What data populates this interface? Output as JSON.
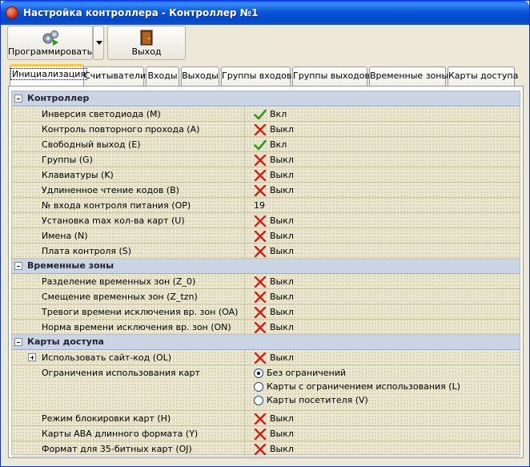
{
  "window": {
    "title": "Настройка контроллера - Контроллер №1"
  },
  "toolbar": {
    "program_label": "Программировать",
    "exit_label": "Выход"
  },
  "tabs": [
    "Инициализация",
    "Считыватели",
    "Входы",
    "Выходы",
    "Группы входов",
    "Группы выходов",
    "Временные зоны",
    "Карты доступа"
  ],
  "active_tab": "Инициализация",
  "colors": {
    "on": "#2e9a1f",
    "off": "#d22018",
    "accent": "#ffc83c"
  },
  "sections": {
    "controller": {
      "title": "Контроллер",
      "rows": [
        {
          "name": "Инверсия светодиода (M)",
          "value": "Вкл",
          "icon": "check-icon"
        },
        {
          "name": "Контроль повторного прохода (A)",
          "value": "Выкл",
          "icon": "cross-icon"
        },
        {
          "name": "Свободный выход (E)",
          "value": "Вкл",
          "icon": "check-icon"
        },
        {
          "name": "Группы (G)",
          "value": "Выкл",
          "icon": "cross-icon"
        },
        {
          "name": "Клавиатуры (K)",
          "value": "Выкл",
          "icon": "cross-icon"
        },
        {
          "name": "Удлиненное чтение кодов (B)",
          "value": "Выкл",
          "icon": "cross-icon"
        },
        {
          "name": "№ входа контроля питания (OP)",
          "value": "19",
          "icon": ""
        },
        {
          "name": "Установка max кол-ва карт (U)",
          "value": "Выкл",
          "icon": "cross-icon"
        },
        {
          "name": "Имена (N)",
          "value": "Выкл",
          "icon": "cross-icon"
        },
        {
          "name": "Плата контроля (S)",
          "value": "Выкл",
          "icon": "cross-icon"
        }
      ]
    },
    "time_zones": {
      "title": "Временные зоны",
      "rows": [
        {
          "name": "Разделение временных зон (Z_0)",
          "value": "Выкл",
          "icon": "cross-icon"
        },
        {
          "name": "Смещение временных зон (Z_tzn)",
          "value": "Выкл",
          "icon": "cross-icon"
        },
        {
          "name": "Тревоги времени исключения вр. зон (OA)",
          "value": "Выкл",
          "icon": "cross-icon"
        },
        {
          "name": "Норма времени исключения вр. зон (ON)",
          "value": "Выкл",
          "icon": "cross-icon"
        }
      ]
    },
    "access_cards": {
      "title": "Карты доступа",
      "site_code": {
        "name": "Использовать сайт-код (OL)",
        "value": "Выкл",
        "icon": "cross-icon"
      },
      "restrictions": {
        "name": "Ограничения использования карт",
        "options": [
          "Без ограничений",
          "Карты с ограничением использования (L)",
          "Карты посетителя (V)"
        ],
        "selected": "Без ограничений"
      },
      "rows": [
        {
          "name": "Режим блокировки карт (H)",
          "value": "Выкл",
          "icon": "cross-icon"
        },
        {
          "name": "Карты ABA длинного формата (Y)",
          "value": "Выкл",
          "icon": "cross-icon"
        },
        {
          "name": "Формат для 35-битных карт (OJ)",
          "value": "Выкл",
          "icon": "cross-icon"
        }
      ]
    }
  }
}
